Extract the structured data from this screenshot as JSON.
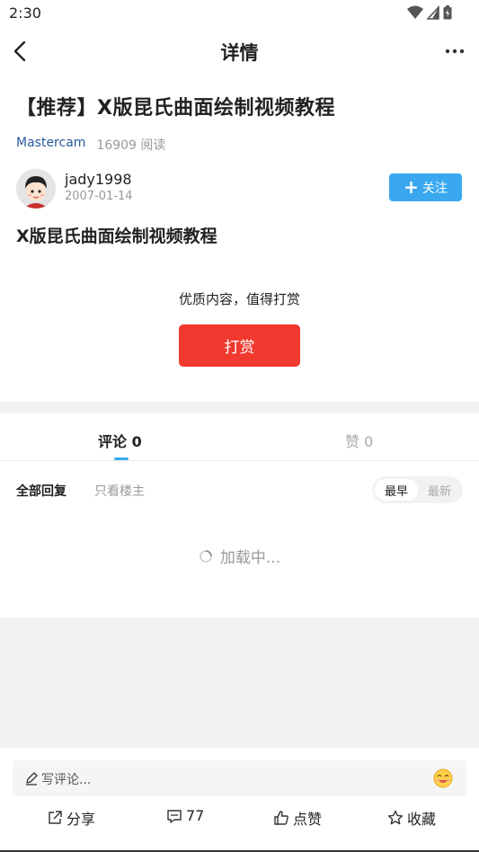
{
  "status_bar": {
    "time": "2:30"
  },
  "nav": {
    "title": "详情"
  },
  "article": {
    "title": "【推荐】X版昆氏曲面绘制视频教程",
    "forum": "Mastercam",
    "views": "16909 阅读",
    "content": "X版昆氏曲面绘制视频教程"
  },
  "author": {
    "name": "jady1998",
    "date": "2007-01-14",
    "follow_label": "关注"
  },
  "reward": {
    "prompt": "优质内容，值得打赏",
    "button_label": "打赏"
  },
  "tabs": {
    "comments": "评论 0",
    "likes": "赞 0"
  },
  "filters": {
    "all_replies": "全部回复",
    "op_only": "只看楼主",
    "sort_earliest": "最早",
    "sort_latest": "最新"
  },
  "loading_text": "加载中...",
  "bottom": {
    "comment_placeholder": "写评论...",
    "share_label": "分享",
    "comment_count": "77",
    "like_label": "点赞",
    "favorite_label": "收藏"
  },
  "colors": {
    "accent_blue": "#3aa8ef",
    "reward_red": "#f03a2f",
    "forum_link": "#2a5a9c"
  }
}
